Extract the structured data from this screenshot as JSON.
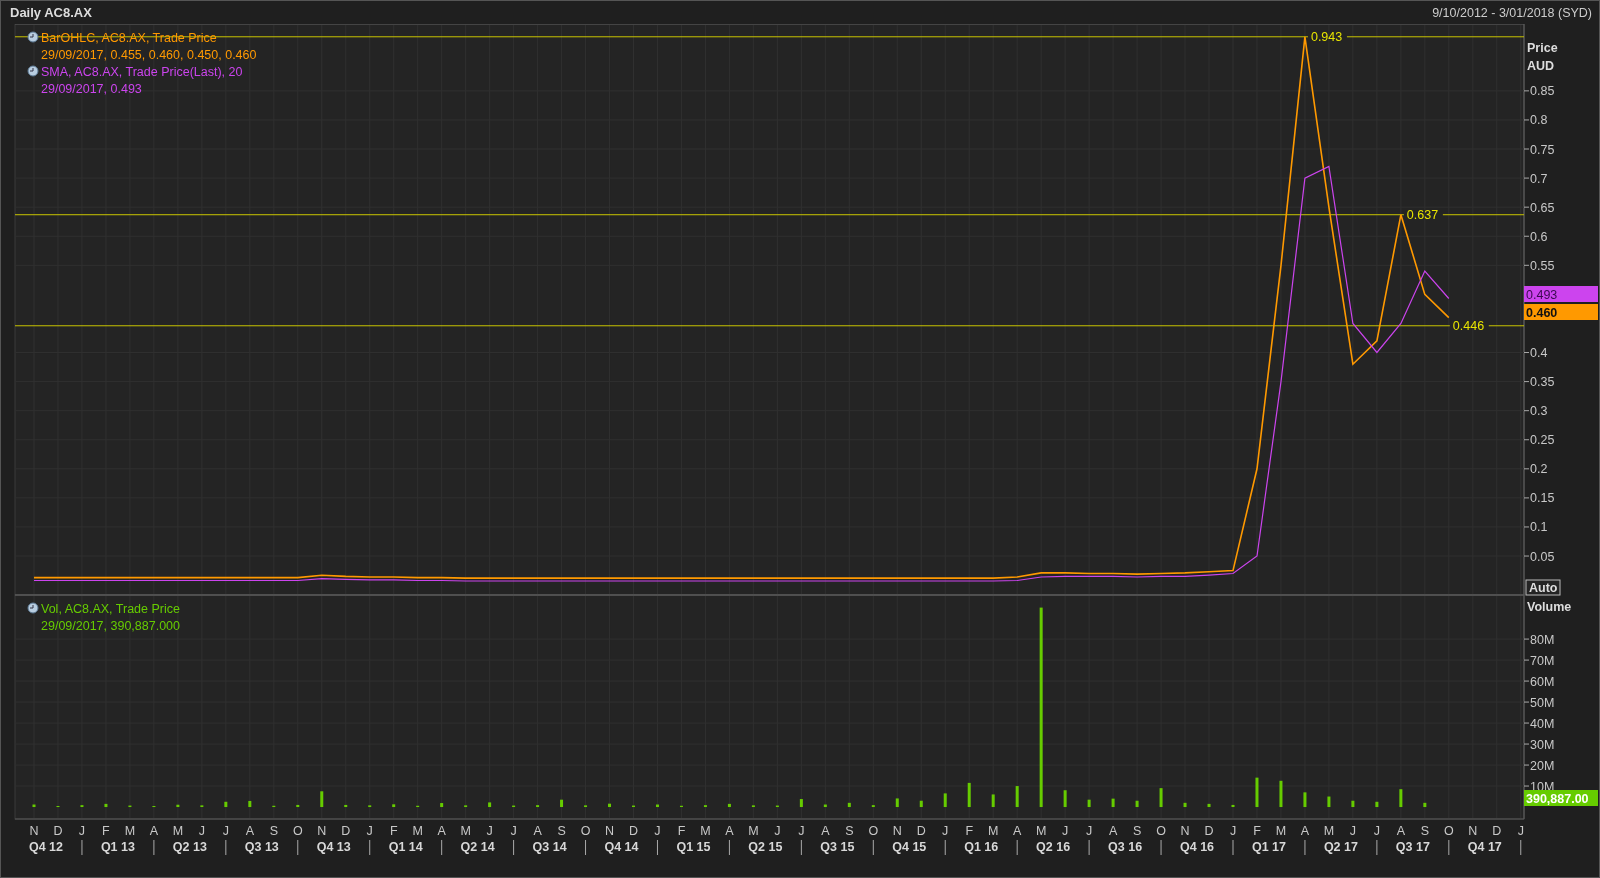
{
  "window": {
    "title": "Daily AC8.AX",
    "date_range": "9/10/2012 - 3/01/2018 (SYD)"
  },
  "price_panel": {
    "axis_title": "Price",
    "axis_unit": "AUD",
    "auto_button": "Auto",
    "value_tags": [
      {
        "text": "0.493",
        "color": "#cc44ee"
      },
      {
        "text": "0.460",
        "color": "#ff9900"
      }
    ],
    "legend": [
      {
        "title": "BarOHLC, AC8.AX, Trade Price",
        "values": "29/09/2017, 0.455, 0.460, 0.450, 0.460"
      },
      {
        "title": "SMA, AC8.AX, Trade Price(Last),  20",
        "values": "29/09/2017, 0.493"
      }
    ],
    "chart_data": {
      "type": "line",
      "grid": true,
      "ylim": [
        -0.017,
        0.965
      ],
      "yticks": [
        {
          "value": 0.05,
          "label": "0.05"
        },
        {
          "value": 0.1,
          "label": "0.1"
        },
        {
          "value": 0.15,
          "label": "0.15"
        },
        {
          "value": 0.2,
          "label": "0.2"
        },
        {
          "value": 0.25,
          "label": "0.25"
        },
        {
          "value": 0.3,
          "label": "0.3"
        },
        {
          "value": 0.35,
          "label": "0.35"
        },
        {
          "value": 0.4,
          "label": "0.4"
        },
        {
          "value": 0.55,
          "label": "0.55"
        },
        {
          "value": 0.6,
          "label": "0.6"
        },
        {
          "value": 0.65,
          "label": "0.65"
        },
        {
          "value": 0.7,
          "label": "0.7"
        },
        {
          "value": 0.75,
          "label": "0.75"
        },
        {
          "value": 0.8,
          "label": "0.8"
        },
        {
          "value": 0.85,
          "label": "0.85"
        }
      ],
      "categories": [
        null,
        null,
        null,
        null,
        null,
        null,
        null,
        null,
        null,
        null,
        null,
        null,
        null,
        null,
        null,
        null,
        null,
        null,
        null,
        null,
        null,
        null,
        null,
        null,
        null,
        null,
        null,
        null,
        null,
        null,
        null,
        null,
        null,
        null,
        null,
        null,
        null,
        null,
        null,
        null,
        null,
        null,
        null,
        null,
        null,
        null,
        null,
        null,
        null,
        null,
        null,
        null,
        null,
        null,
        null,
        null,
        null,
        null,
        null,
        null,
        null,
        null,
        null
      ],
      "series": [
        {
          "color": "#ff9900",
          "values": [
            0.013,
            0.013,
            0.013,
            0.013,
            0.013,
            0.013,
            0.013,
            0.013,
            0.013,
            0.013,
            0.013,
            0.013,
            0.017,
            0.015,
            0.014,
            0.014,
            0.013,
            0.013,
            0.012,
            0.012,
            0.012,
            0.012,
            0.012,
            0.012,
            0.012,
            0.012,
            0.012,
            0.012,
            0.012,
            0.012,
            0.012,
            0.012,
            0.012,
            0.012,
            0.012,
            0.012,
            0.012,
            0.012,
            0.012,
            0.012,
            0.012,
            0.014,
            0.021,
            0.021,
            0.02,
            0.02,
            0.019,
            0.02,
            0.021,
            0.023,
            0.025,
            0.2,
            0.55,
            0.943,
            0.65,
            0.38,
            0.42,
            0.637,
            0.5,
            0.46,
            null,
            null,
            null
          ]
        },
        {
          "color": "#cc44ee",
          "values": [
            0.008,
            0.008,
            0.008,
            0.008,
            0.008,
            0.008,
            0.008,
            0.008,
            0.008,
            0.008,
            0.008,
            0.008,
            0.011,
            0.01,
            0.009,
            0.009,
            0.008,
            0.008,
            0.007,
            0.007,
            0.007,
            0.007,
            0.007,
            0.007,
            0.007,
            0.007,
            0.007,
            0.007,
            0.007,
            0.007,
            0.007,
            0.007,
            0.007,
            0.007,
            0.007,
            0.007,
            0.007,
            0.007,
            0.007,
            0.007,
            0.007,
            0.008,
            0.014,
            0.015,
            0.015,
            0.015,
            0.014,
            0.015,
            0.015,
            0.017,
            0.02,
            0.05,
            0.35,
            0.7,
            0.72,
            0.45,
            0.4,
            0.45,
            0.54,
            0.493,
            null,
            null,
            null
          ]
        }
      ],
      "ref_lines": [
        {
          "axis": "y",
          "value": 0.943,
          "label": "0.943",
          "color": "#c8c400"
        },
        {
          "axis": "y",
          "value": 0.637,
          "label": "0.637",
          "color": "#c8c400"
        },
        {
          "axis": "y",
          "value": 0.446,
          "label": "0.446",
          "color": "#c8c400"
        }
      ]
    }
  },
  "volume_panel": {
    "axis_title": "Volume",
    "value_tags": [
      {
        "text": "390,887.00",
        "color": "#66cc00"
      }
    ],
    "legend": [
      {
        "title": "Vol, AC8.AX, Trade Price",
        "values": "29/09/2017, 390,887.000"
      }
    ],
    "chart_data": {
      "type": "bar",
      "grid": true,
      "ylim": [
        -5.7,
        101
      ],
      "yticks": [
        {
          "value": 10,
          "label": "10M"
        },
        {
          "value": 20,
          "label": "20M"
        },
        {
          "value": 30,
          "label": "30M"
        },
        {
          "value": 40,
          "label": "40M"
        },
        {
          "value": 50,
          "label": "50M"
        },
        {
          "value": 60,
          "label": "60M"
        },
        {
          "value": 70,
          "label": "70M"
        },
        {
          "value": 80,
          "label": "80M"
        }
      ],
      "categories": [
        "N",
        "D",
        "J",
        "F",
        "M",
        "A",
        "M",
        "J",
        "J",
        "A",
        "S",
        "O",
        "N",
        "D",
        "J",
        "F",
        "M",
        "A",
        "M",
        "J",
        "J",
        "A",
        "S",
        "O",
        "N",
        "D",
        "J",
        "F",
        "M",
        "A",
        "M",
        "J",
        "J",
        "A",
        "S",
        "O",
        "N",
        "D",
        "J",
        "F",
        "M",
        "A",
        "M",
        "J",
        "J",
        "A",
        "S",
        "O",
        "N",
        "D",
        "J",
        "F",
        "M",
        "A",
        "M",
        "J",
        "J",
        "A",
        "S",
        "O",
        "N",
        "D",
        "J"
      ],
      "series": [
        {
          "color": "#66cc00",
          "values": [
            1.2,
            0.5,
            0.9,
            1.5,
            0.7,
            0.5,
            1.1,
            0.8,
            2.5,
            2.9,
            0.6,
            1,
            7.5,
            1,
            0.8,
            1.3,
            0.6,
            1.9,
            0.8,
            2.2,
            0.7,
            0.9,
            3.5,
            0.8,
            1.6,
            0.7,
            1.2,
            0.6,
            0.9,
            1.5,
            0.8,
            0.7,
            3.8,
            1.2,
            2,
            0.9,
            4.1,
            3,
            6.5,
            11.5,
            6,
            10,
            95,
            8,
            3.5,
            4,
            3,
            9,
            2,
            1.5,
            1,
            14,
            12.5,
            7,
            5,
            3,
            2.5,
            8.5,
            2,
            null,
            null,
            null,
            null
          ]
        }
      ]
    }
  },
  "time_axis": {
    "quarters": [
      "Q4 12",
      "Q1 13",
      "Q2 13",
      "Q3 13",
      "Q4 13",
      "Q1 14",
      "Q2 14",
      "Q3 14",
      "Q4 14",
      "Q1 15",
      "Q2 15",
      "Q3 15",
      "Q4 15",
      "Q1 16",
      "Q2 16",
      "Q3 16",
      "Q4 16",
      "Q1 17",
      "Q2 17",
      "Q3 17",
      "Q4 17"
    ]
  }
}
